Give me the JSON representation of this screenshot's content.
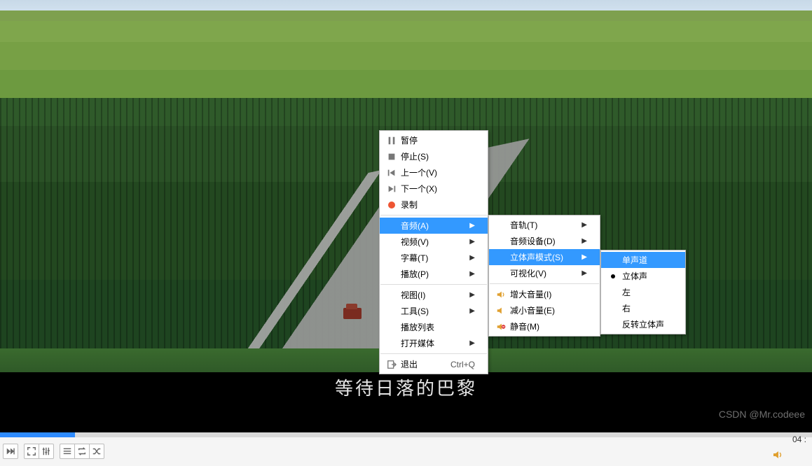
{
  "subtitle": "等待日落的巴黎",
  "watermark": "CSDN @Mr.codeee",
  "time_display": "04 :",
  "menu1": {
    "pause": "暂停",
    "stop": "停止(S)",
    "prev": "上一个(V)",
    "next": "下一个(X)",
    "record": "录制",
    "audio": "音频(A)",
    "video": "视频(V)",
    "subtitle": "字幕(T)",
    "playback": "播放(P)",
    "view": "视图(I)",
    "tools": "工具(S)",
    "playlist": "播放列表",
    "openmedia": "打开媒体",
    "quit": "退出",
    "quit_accel": "Ctrl+Q"
  },
  "menu2": {
    "track": "音轨(T)",
    "device": "音频设备(D)",
    "stereo": "立体声模式(S)",
    "visual": "可视化(V)",
    "volup": "增大音量(I)",
    "voldown": "减小音量(E)",
    "mute": "静音(M)"
  },
  "menu3": {
    "mono": "单声道",
    "stereo": "立体声",
    "left": "左",
    "right": "右",
    "reverse": "反转立体声"
  }
}
